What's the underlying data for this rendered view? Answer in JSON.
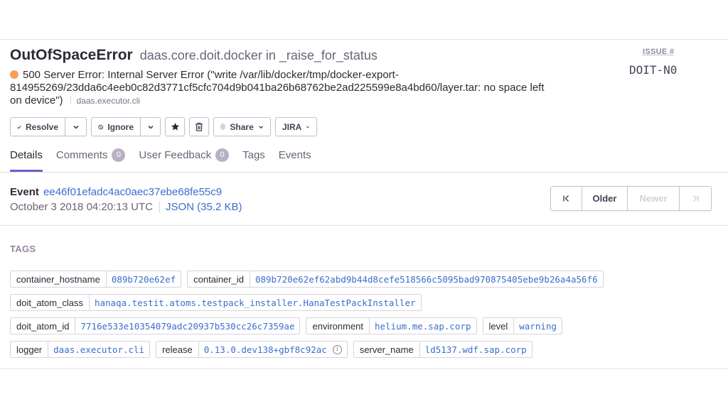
{
  "issue": {
    "title": "OutOfSpaceError",
    "culprit": "daas.core.doit.docker in _raise_for_status",
    "issue_label": "ISSUE #",
    "issue_id": "DOIT-N0",
    "message": "500 Server Error: Internal Server Error (\"write /var/lib/docker/tmp/docker-export-814955269/23dda6c4eeb0c82d3771cf5cfc704d9b041ba26b68762be2ad225599e8a4bd60/layer.tar: no space left on device\")",
    "location": "daas.executor.cli",
    "level_color": "#f5a05b"
  },
  "toolbar": {
    "resolve_label": "Resolve",
    "ignore_label": "Ignore",
    "share_label": "Share",
    "jira_label": "JIRA"
  },
  "tabs": [
    {
      "label": "Details",
      "active": true
    },
    {
      "label": "Comments",
      "count": "0"
    },
    {
      "label": "User Feedback",
      "count": "0"
    },
    {
      "label": "Tags"
    },
    {
      "label": "Events"
    }
  ],
  "event": {
    "label": "Event",
    "id": "ee46f01efadc4ac0aec37ebe68fe55c9",
    "date": "October 3 2018 04:20:13 UTC",
    "json_link": "JSON (35.2 KB)"
  },
  "pager": {
    "older": "Older",
    "newer": "Newer"
  },
  "tags_heading": "TAGS",
  "tags": [
    [
      {
        "key": "container_hostname",
        "value": "089b720e62ef"
      },
      {
        "key": "container_id",
        "value": "089b720e62ef62abd9b44d8cefe518566c5095bad970875405ebe9b26a4a56f6"
      }
    ],
    [
      {
        "key": "doit_atom_class",
        "value": "hanaqa.testit.atoms.testpack_installer.HanaTestPackInstaller"
      }
    ],
    [
      {
        "key": "doit_atom_id",
        "value": "7716e533e10354079adc20937b530cc26c7359ae"
      },
      {
        "key": "environment",
        "value": "helium.me.sap.corp"
      },
      {
        "key": "level",
        "value": "warning"
      }
    ],
    [
      {
        "key": "logger",
        "value": "daas.executor.cli"
      },
      {
        "key": "release",
        "value": "0.13.0.dev138+gbf8c92ac",
        "info": true
      },
      {
        "key": "server_name",
        "value": "ld5137.wdf.sap.corp"
      }
    ]
  ]
}
